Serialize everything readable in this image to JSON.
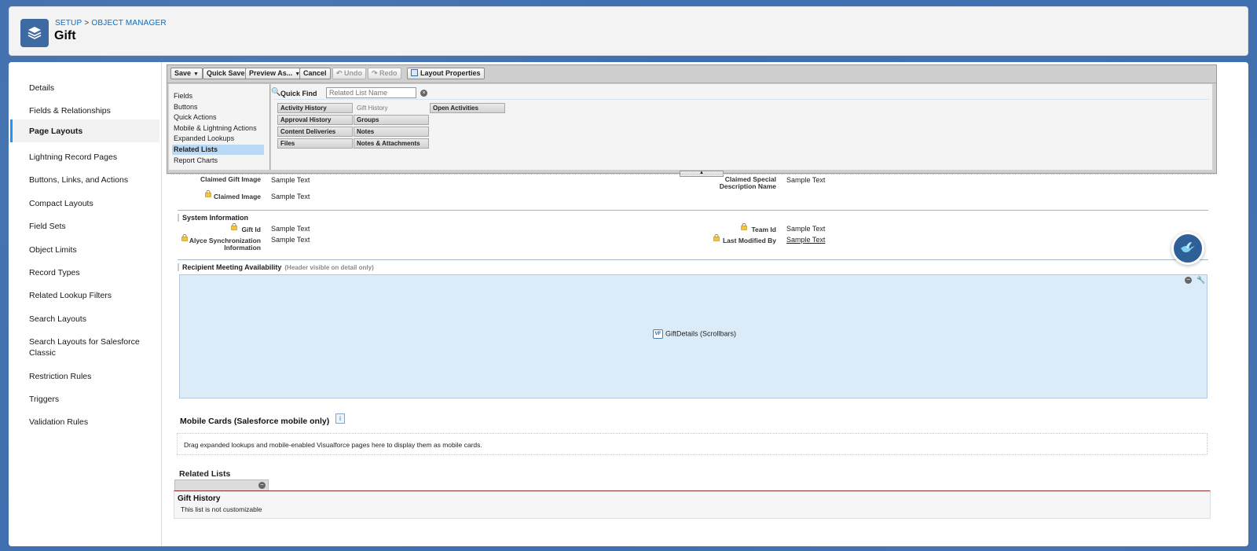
{
  "header": {
    "breadcrumb": [
      "SETUP",
      "OBJECT MANAGER"
    ],
    "breadcrumb_sep": ">",
    "title": "Gift"
  },
  "sidebar": {
    "items": [
      {
        "label": "Details"
      },
      {
        "label": "Fields & Relationships"
      },
      {
        "label": "Page Layouts",
        "active": true
      },
      {
        "label": "Lightning Record Pages"
      },
      {
        "label": "Buttons, Links, and Actions"
      },
      {
        "label": "Compact Layouts"
      },
      {
        "label": "Field Sets"
      },
      {
        "label": "Object Limits"
      },
      {
        "label": "Record Types"
      },
      {
        "label": "Related Lookup Filters"
      },
      {
        "label": "Search Layouts"
      },
      {
        "label": "Search Layouts for Salesforce Classic"
      },
      {
        "label": "Restriction Rules"
      },
      {
        "label": "Triggers"
      },
      {
        "label": "Validation Rules"
      }
    ]
  },
  "toolbar": {
    "save": "Save",
    "quick_save": "Quick Save",
    "preview_as": "Preview As...",
    "cancel": "Cancel",
    "undo": "Undo",
    "redo": "Redo",
    "layout_properties": "Layout Properties"
  },
  "palette": {
    "categories": [
      "Fields",
      "Buttons",
      "Quick Actions",
      "Mobile & Lightning Actions",
      "Expanded Lookups",
      "Related Lists",
      "Report Charts"
    ],
    "active_category": "Related Lists",
    "quick_find_label": "Quick Find",
    "quick_find_placeholder": "Related List Name",
    "items": [
      "Activity History",
      "Gift History",
      "Open Activities",
      "Approval History",
      "Groups",
      "Content Deliveries",
      "Notes",
      "Files",
      "Notes & Attachments"
    ]
  },
  "layout": {
    "fields_top": {
      "claimed_gift_image_label": "Claimed Gift Image",
      "claimed_gift_image_value": "Sample Text",
      "claimed_image_label": "Claimed Image",
      "claimed_image_value": "Sample Text",
      "claimed_special_label": "Claimed Special Description Name",
      "claimed_special_value": "Sample Text"
    },
    "system_info": {
      "title": "System Information",
      "gift_id_label": "Gift Id",
      "gift_id_value": "Sample Text",
      "alyce_label": "Alyce Synchronization Information",
      "alyce_value": "Sample Text",
      "team_id_label": "Team Id",
      "team_id_value": "Sample Text",
      "last_modified_label": "Last Modified By",
      "last_modified_value": "Sample Text"
    },
    "recipient": {
      "title": "Recipient Meeting Availability",
      "hint": "(Header visible on detail only)",
      "vf_badge": "VF",
      "vf_label": "GiftDetails (Scrollbars)"
    },
    "mobile_cards": {
      "title": "Mobile Cards (Salesforce mobile only)",
      "info": "i",
      "text": "Drag expanded lookups and mobile-enabled Visualforce pages here to display them as mobile cards."
    },
    "related_lists": {
      "title": "Related Lists",
      "name": "Gift History",
      "note": "This list is not customizable"
    }
  }
}
